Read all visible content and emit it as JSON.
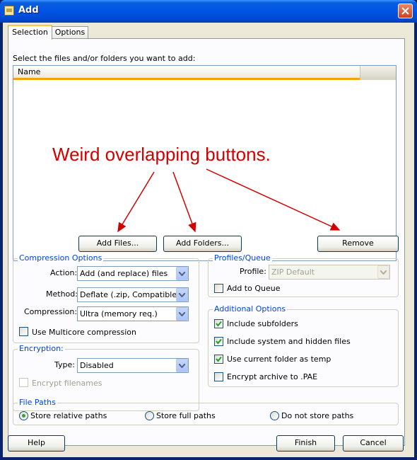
{
  "window": {
    "title": "Add"
  },
  "tabs": [
    {
      "label": "Selection"
    },
    {
      "label": "Options"
    }
  ],
  "selection": {
    "prompt": "Select the files and/or folders you want to add:",
    "list_header": "Name",
    "add_files_label": "Add Files...",
    "add_folders_label": "Add Folders...",
    "remove_label": "Remove"
  },
  "annotation": {
    "text": "Weird overlapping buttons.",
    "color": "#d30000"
  },
  "compression": {
    "title": "Compression Options",
    "action_label": "Action:",
    "action_value": "Add (and replace) files",
    "method_label": "Method:",
    "method_value": "Deflate (.zip, Compatible)",
    "compression_label": "Compression:",
    "compression_value": "Ultra (memory req.)",
    "multicore_label": "Use Multicore compression",
    "multicore_checked": false
  },
  "encryption": {
    "title": "Encryption:",
    "type_label": "Type:",
    "type_value": "Disabled",
    "encrypt_filenames_label": "Encrypt filenames",
    "encrypt_filenames_checked": false
  },
  "profiles": {
    "title": "Profiles/Queue",
    "profile_label": "Profile:",
    "profile_value": "ZIP Default",
    "add_to_queue_label": "Add to Queue",
    "add_to_queue_checked": false
  },
  "additional": {
    "title": "Additional Options",
    "items": [
      {
        "label": "Include subfolders",
        "checked": true
      },
      {
        "label": "Include system and hidden files",
        "checked": true
      },
      {
        "label": "Use current folder as temp",
        "checked": true
      },
      {
        "label": "Encrypt archive to .PAE",
        "checked": false
      }
    ]
  },
  "file_paths": {
    "title": "File Paths",
    "options": [
      {
        "label": "Store relative paths",
        "selected": true
      },
      {
        "label": "Store full paths",
        "selected": false
      },
      {
        "label": "Do not store paths",
        "selected": false
      }
    ]
  },
  "footer": {
    "help_label": "Help",
    "finish_label": "Finish",
    "cancel_label": "Cancel"
  },
  "colors": {
    "accent": "#0046d5",
    "title_bar": "#0054e3",
    "header_underline": "#f0a30a"
  }
}
